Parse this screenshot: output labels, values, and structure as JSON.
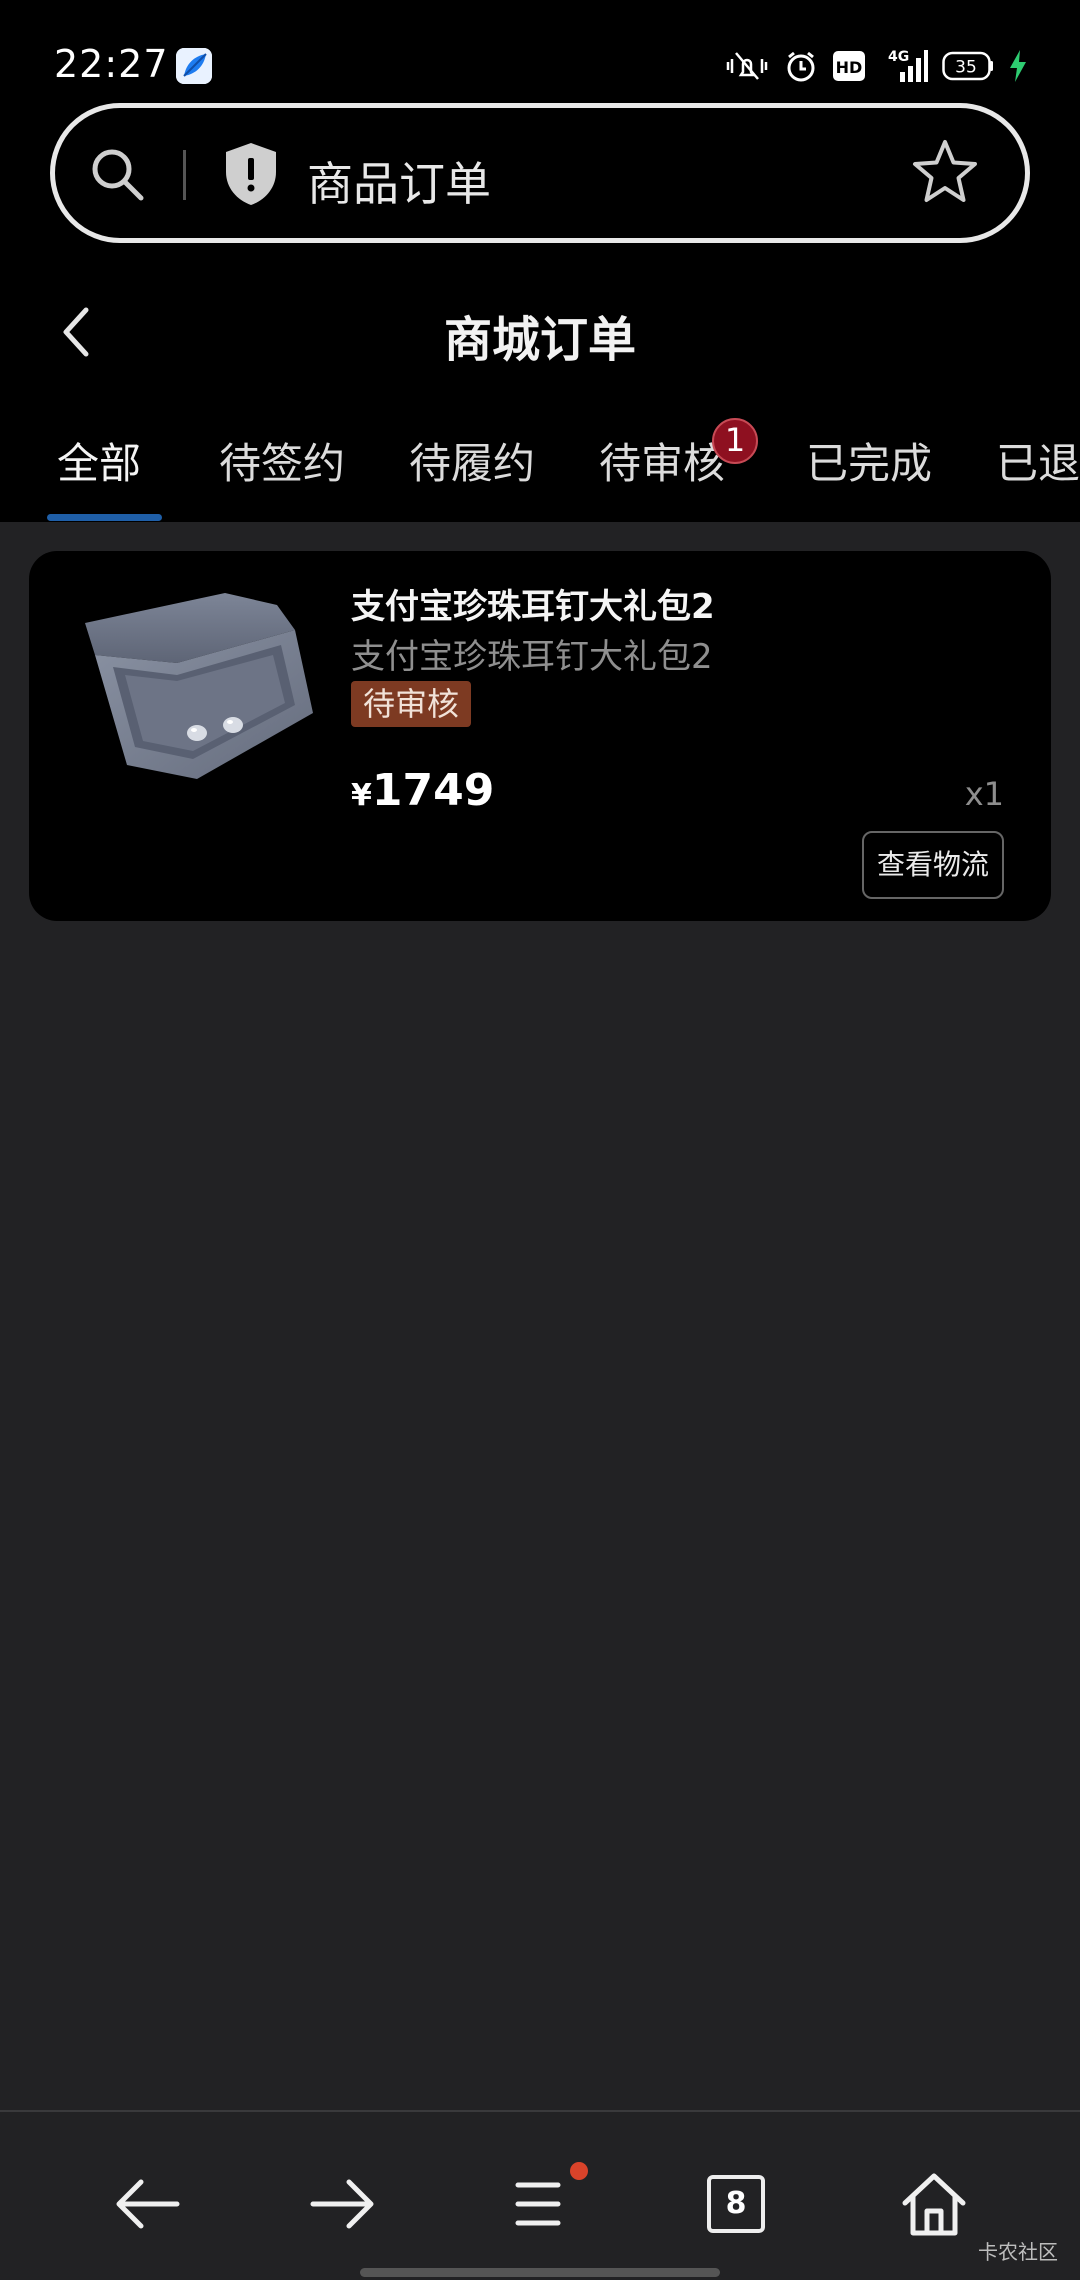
{
  "status_bar": {
    "time": "22:27",
    "network": "4G",
    "hd_label": "HD",
    "battery": "35"
  },
  "address_bar": {
    "title": "商品订单"
  },
  "header": {
    "title": "商城订单"
  },
  "tabs": [
    {
      "label": "全部",
      "active": true
    },
    {
      "label": "待签约"
    },
    {
      "label": "待履约"
    },
    {
      "label": "待审核",
      "badge": "1"
    },
    {
      "label": "已完成"
    },
    {
      "label": "已退款"
    }
  ],
  "orders": [
    {
      "name": "支付宝珍珠耳钉大礼包2",
      "subtitle": "支付宝珍珠耳钉大礼包2",
      "status": "待审核",
      "currency": "¥",
      "price": "1749",
      "quantity": "x1",
      "action_label": "查看物流"
    }
  ],
  "bottom_nav": {
    "tabs_count": "8",
    "icons": [
      "back-arrow-icon",
      "forward-arrow-icon",
      "menu-icon",
      "tabs-icon",
      "home-icon"
    ]
  },
  "watermark": "卡农社区",
  "colors": {
    "accent_underline": "#1f5fa8",
    "status_badge_bg": "#7d3a22",
    "notification_badge": "#8e1020",
    "charging_green": "#2ecc71"
  }
}
